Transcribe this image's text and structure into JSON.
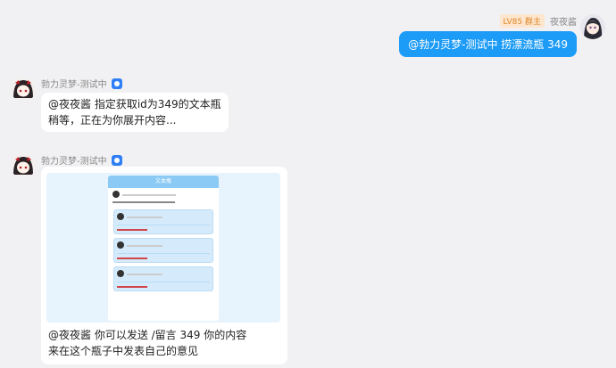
{
  "outgoing": {
    "badge": "LV85 群主",
    "sender": "夜夜酱",
    "text": "@勃力灵梦-测试中 捞漂流瓶 349"
  },
  "bot": {
    "name": "勃力灵梦-测试中"
  },
  "reply1": {
    "line1": "@夜夜酱 指定获取id为349的文本瓶",
    "line2": "稍等，正在为你展开内容..."
  },
  "reply2": {
    "card_title": "文本瓶",
    "line1": "@夜夜酱 你可以发送 /留言 349 你的内容",
    "line2": "来在这个瓶子中发表自己的意见"
  }
}
